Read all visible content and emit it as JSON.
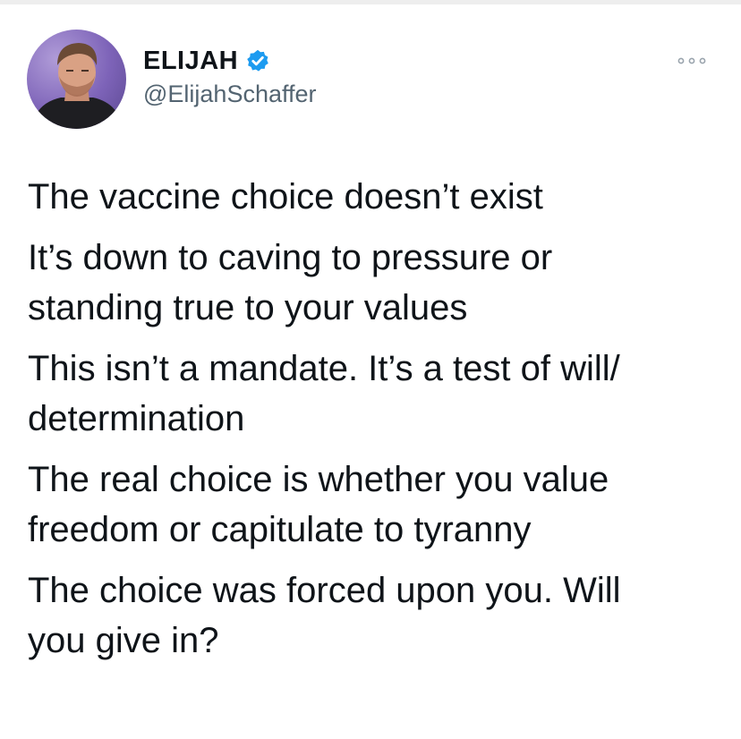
{
  "author": {
    "display_name": "ELIJAH",
    "handle": "@ElijahSchaffer",
    "verified": true,
    "avatar_icon": "person-avatar-icon",
    "verified_icon": "verified-badge-icon",
    "more_icon": "more-options-icon"
  },
  "tweet": {
    "paragraphs": [
      "The vaccine choice doesn’t exist",
      "It’s down to caving to pressure or\nstanding true to your values",
      "This isn’t a mandate. It’s a test of will/\ndetermination",
      "The real choice is whether you value\nfreedom or capitulate to tyranny",
      "The choice was forced upon you. Will\nyou give in?"
    ]
  },
  "colors": {
    "text": "#0f1419",
    "secondary": "#536471",
    "verified_blue": "#1d9bf0",
    "avatar_bg": "#8a70c4"
  }
}
